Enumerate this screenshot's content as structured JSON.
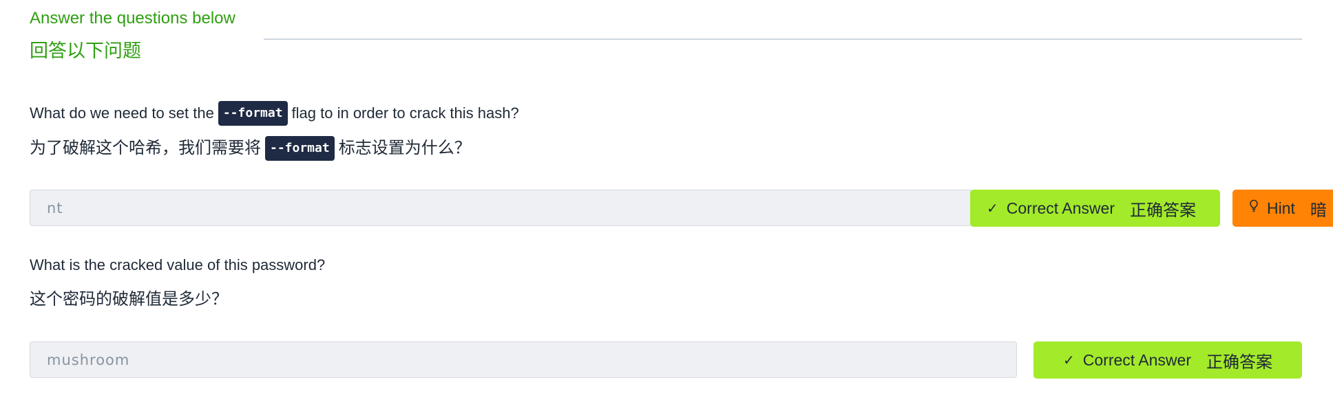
{
  "section": {
    "title_en": "Answer the questions below",
    "title_zh": "回答以下问题"
  },
  "questions": [
    {
      "text_en_before": "What do we need to set the",
      "code": "--format",
      "text_en_after": "flag to in order to crack this hash?",
      "text_zh_before": "为了破解这个哈希，我们需要将",
      "text_zh_after": "标志设置为什么？",
      "answer": "nt",
      "correct_label_en": "Correct Answer",
      "correct_label_zh": "正确答案",
      "hint_label_en": "Hint",
      "hint_label_zh": "暗"
    },
    {
      "text_en": "What is the cracked value of this password?",
      "text_zh": "这个密码的破解值是多少？",
      "answer": "mushroom",
      "correct_label_en": "Correct Answer",
      "correct_label_zh": "正确答案"
    }
  ],
  "icons": {
    "check": "check-icon",
    "hint": "lightbulb-icon"
  },
  "colors": {
    "accent_green": "#2e9f10",
    "correct_bg": "#a3ea2a",
    "hint_bg": "#ff8304",
    "code_bg": "#1f2a44",
    "input_bg": "#eef0f3"
  }
}
